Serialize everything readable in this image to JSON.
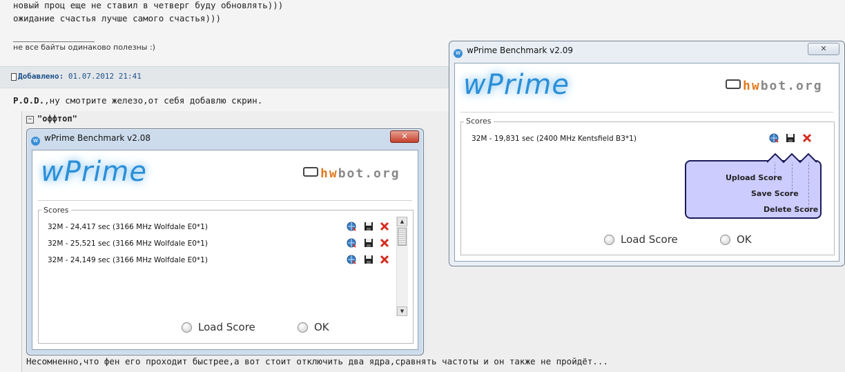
{
  "forum": {
    "post_lines": [
      "новый проц еще не ставил в четверг буду обновлять)))",
      "ожидание счастья лучше самого счастья)))"
    ],
    "signature": "не все байты одинаково полезны :)",
    "added_label": "Добавлено:",
    "added_date": "01.07.2012 21:41",
    "author_ref": "P.O.D.",
    "body_text": ",ну смотрите железо,от себя добавлю скрин.",
    "spoiler_title": "\"оффтоп\"",
    "bottom_text": "Несомненно,что фен его проходит быстрее,а вот стоит отключить два ядра,сравнять частоты и он также не пройдёт..."
  },
  "window_left": {
    "title": "wPrime Benchmark v2.08",
    "logo": "wPrime",
    "hwbot": {
      "a": "h",
      "b": "w",
      "c": "bot",
      "d": ".org"
    },
    "scores_label": "Scores",
    "scores": [
      "32M - 24,417 sec (3166 MHz Wolfdale E0*1)",
      "32M - 25,521 sec (3166 MHz Wolfdale E0*1)",
      "32M - 24,149 sec (3166 MHz Wolfdale E0*1)"
    ],
    "load_score": "Load Score",
    "ok": "OK"
  },
  "window_right": {
    "title": "wPrime Benchmark v2.09",
    "logo": "wPrime",
    "hwbot": {
      "a": "h",
      "b": "w",
      "c": "bot",
      "d": ".org"
    },
    "scores_label": "Scores",
    "scores": [
      "32M - 19,831 sec (2400 MHz Kentsfield B3*1)"
    ],
    "popup": {
      "upload": "Upload Score",
      "save": "Save Score",
      "delete": "Delete Score"
    },
    "load_score": "Load Score",
    "ok": "OK"
  },
  "icons": {
    "upload": "globe-upload-icon",
    "save": "floppy-disk-icon",
    "delete": "red-x-icon",
    "close": "close-icon"
  },
  "colors": {
    "logo_blue": "#2a8fd8",
    "hwbot_orange": "#e0791f",
    "popup_bg": "#ccccff",
    "delete_red": "#d42b1e"
  }
}
